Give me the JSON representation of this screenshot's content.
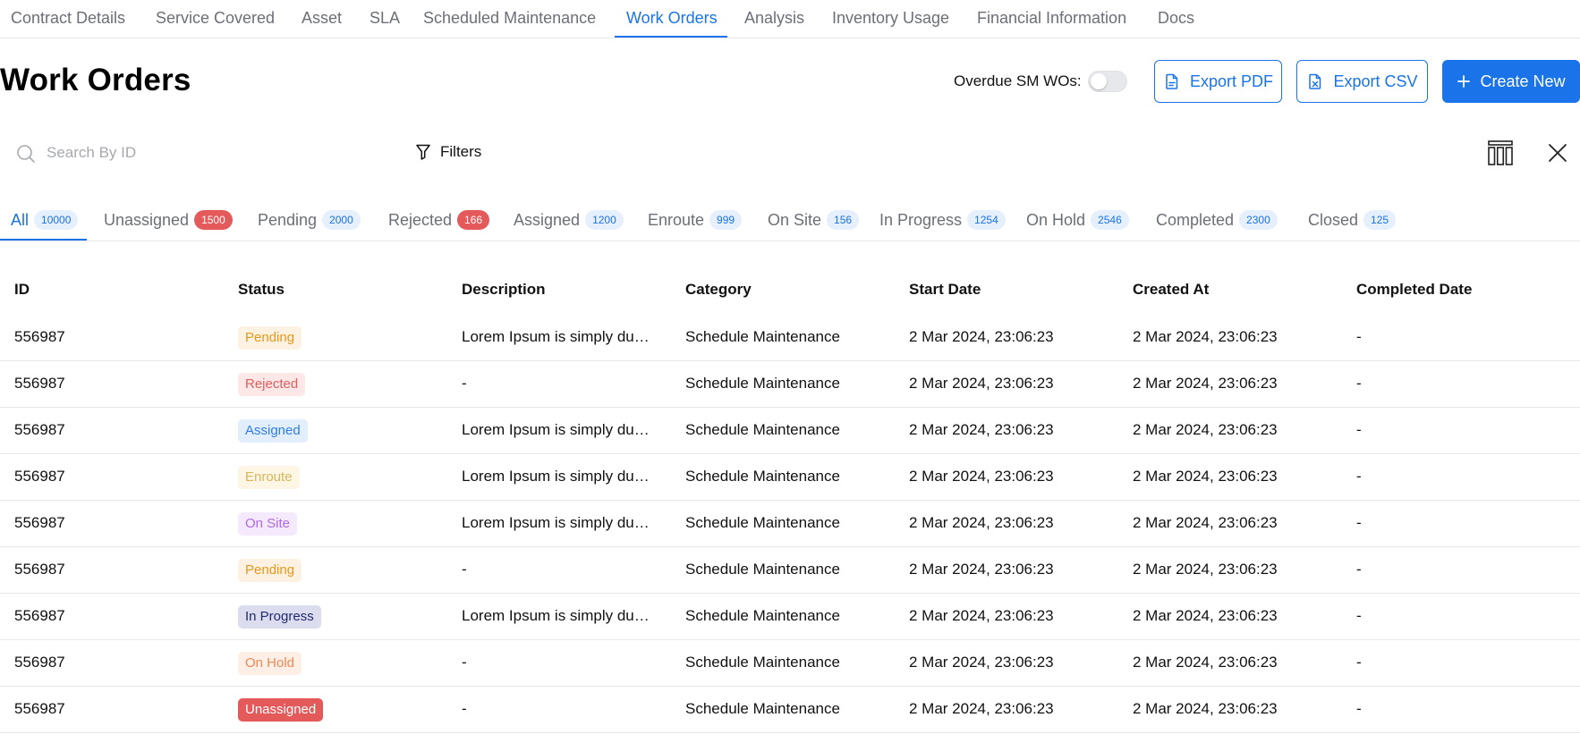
{
  "top_tabs": [
    "Contract Details",
    "Service Covered",
    "Asset",
    "SLA",
    "Scheduled Maintenance",
    "Work Orders",
    "Analysis",
    "Inventory Usage",
    "Financial Information",
    "Docs"
  ],
  "page_title": "Work Orders",
  "overdue_label": "Overdue SM WOs:",
  "overdue_toggle_on": false,
  "buttons": {
    "export_pdf": "Export PDF",
    "export_csv": "Export CSV",
    "create_new": "Create New"
  },
  "search": {
    "placeholder": "Search By ID"
  },
  "filters_label": "Filters",
  "status_tabs": [
    {
      "label": "All",
      "count": "10000"
    },
    {
      "label": "Unassigned",
      "count": "1500"
    },
    {
      "label": "Pending",
      "count": "2000"
    },
    {
      "label": "Rejected",
      "count": "166"
    },
    {
      "label": "Assigned",
      "count": "1200"
    },
    {
      "label": "Enroute",
      "count": "999"
    },
    {
      "label": "On Site",
      "count": "156"
    },
    {
      "label": "In Progress",
      "count": "1254"
    },
    {
      "label": "On Hold",
      "count": "2546"
    },
    {
      "label": "Completed",
      "count": "2300"
    },
    {
      "label": "Closed",
      "count": "125"
    }
  ],
  "colors": {
    "accent": "#1a73e8",
    "alert_badge": "#e4595a"
  },
  "table": {
    "headers": [
      "ID",
      "Status",
      "Description",
      "Category",
      "Start Date",
      "Created At",
      "Completed Date"
    ],
    "rows": [
      {
        "id": "556987",
        "status": "Pending",
        "description": "Lorem Ipsum is simply dummy text",
        "category": "Schedule Maintenance",
        "start": "2 Mar 2024, 23:06:23",
        "created": "2 Mar 2024, 23:06:23",
        "completed": "-"
      },
      {
        "id": "556987",
        "status": "Rejected",
        "description": "-",
        "category": "Schedule Maintenance",
        "start": "2 Mar 2024, 23:06:23",
        "created": "2 Mar 2024, 23:06:23",
        "completed": "-"
      },
      {
        "id": "556987",
        "status": "Assigned",
        "description": "Lorem Ipsum is simply dummy text",
        "category": "Schedule Maintenance",
        "start": "2 Mar 2024, 23:06:23",
        "created": "2 Mar 2024, 23:06:23",
        "completed": "-"
      },
      {
        "id": "556987",
        "status": "Enroute",
        "description": "Lorem Ipsum is simply dummy text",
        "category": "Schedule Maintenance",
        "start": "2 Mar 2024, 23:06:23",
        "created": "2 Mar 2024, 23:06:23",
        "completed": "-"
      },
      {
        "id": "556987",
        "status": "On Site",
        "description": "Lorem Ipsum is simply dummy text",
        "category": "Schedule Maintenance",
        "start": "2 Mar 2024, 23:06:23",
        "created": "2 Mar 2024, 23:06:23",
        "completed": "-"
      },
      {
        "id": "556987",
        "status": "Pending",
        "description": "-",
        "category": "Schedule Maintenance",
        "start": "2 Mar 2024, 23:06:23",
        "created": "2 Mar 2024, 23:06:23",
        "completed": "-"
      },
      {
        "id": "556987",
        "status": "In Progress",
        "description": "Lorem Ipsum is simply dummy text",
        "category": "Schedule Maintenance",
        "start": "2 Mar 2024, 23:06:23",
        "created": "2 Mar 2024, 23:06:23",
        "completed": "-"
      },
      {
        "id": "556987",
        "status": "On Hold",
        "description": "-",
        "category": "Schedule Maintenance",
        "start": "2 Mar 2024, 23:06:23",
        "created": "2 Mar 2024, 23:06:23",
        "completed": "-"
      },
      {
        "id": "556987",
        "status": "Unassigned",
        "description": "-",
        "category": "Schedule Maintenance",
        "start": "2 Mar 2024, 23:06:23",
        "created": "2 Mar 2024, 23:06:23",
        "completed": "-"
      }
    ]
  }
}
